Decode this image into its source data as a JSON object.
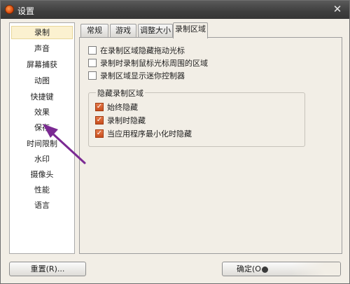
{
  "window": {
    "title": "设置",
    "close_glyph": "✕"
  },
  "sidebar": {
    "items": [
      {
        "label": "录制",
        "selected": true
      },
      {
        "label": "声音"
      },
      {
        "label": "屏幕捕获"
      },
      {
        "label": "动图"
      },
      {
        "label": "快捷键"
      },
      {
        "label": "效果"
      },
      {
        "label": "保存"
      },
      {
        "label": "时间限制"
      },
      {
        "label": "水印"
      },
      {
        "label": "摄像头"
      },
      {
        "label": "性能"
      },
      {
        "label": "语言"
      }
    ]
  },
  "tabs": [
    {
      "label": "常规"
    },
    {
      "label": "游戏"
    },
    {
      "label": "调整大小"
    },
    {
      "label": "录制区域",
      "active": true
    }
  ],
  "options": [
    {
      "label": "在录制区域隐藏拖动光标",
      "checked": false
    },
    {
      "label": "录制时录制鼠标光标周围的区域",
      "checked": false
    },
    {
      "label": "录制区域显示迷你控制器",
      "checked": false
    }
  ],
  "hide_group": {
    "title": "隐藏录制区域",
    "options": [
      {
        "label": "始终隐藏",
        "checked": true
      },
      {
        "label": "录制时隐藏",
        "checked": true
      },
      {
        "label": "当应用程序最小化时隐藏",
        "checked": true
      }
    ]
  },
  "footer": {
    "reset_label": "重置(R)...",
    "ok_label": "确定(O"
  },
  "colors": {
    "accent_check": "#d4592a",
    "annotation_arrow": "#7b2a93"
  },
  "icons": {
    "app": "app-record-icon",
    "close": "close-icon",
    "check": "checkmark-icon"
  }
}
